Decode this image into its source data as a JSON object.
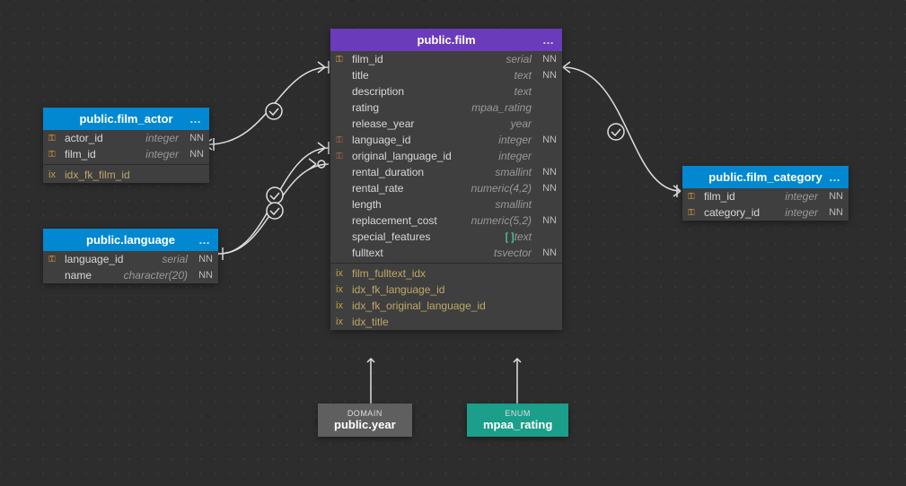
{
  "entities": {
    "film_actor": {
      "title": "public.film_actor",
      "columns": [
        {
          "icon": "pk",
          "name": "actor_id",
          "type": "integer",
          "nn": "NN"
        },
        {
          "icon": "pk",
          "name": "film_id",
          "type": "integer",
          "nn": "NN"
        }
      ],
      "indexes": [
        {
          "name": "idx_fk_film_id"
        }
      ]
    },
    "language": {
      "title": "public.language",
      "columns": [
        {
          "icon": "pk",
          "name": "language_id",
          "type": "serial",
          "nn": "NN"
        },
        {
          "icon": "",
          "name": "name",
          "type": "character(20)",
          "nn": "NN"
        }
      ],
      "indexes": []
    },
    "film": {
      "title": "public.film",
      "columns": [
        {
          "icon": "pk",
          "name": "film_id",
          "type": "serial",
          "nn": "NN"
        },
        {
          "icon": "",
          "name": "title",
          "type": "text",
          "nn": "NN"
        },
        {
          "icon": "",
          "name": "description",
          "type": "text",
          "nn": ""
        },
        {
          "icon": "",
          "name": "rating",
          "type": "mpaa_rating",
          "nn": ""
        },
        {
          "icon": "",
          "name": "release_year",
          "type": "year",
          "nn": ""
        },
        {
          "icon": "fk",
          "name": "language_id",
          "type": "integer",
          "nn": "NN"
        },
        {
          "icon": "fk",
          "name": "original_language_id",
          "type": "integer",
          "nn": ""
        },
        {
          "icon": "",
          "name": "rental_duration",
          "type": "smallint",
          "nn": "NN"
        },
        {
          "icon": "",
          "name": "rental_rate",
          "type": "numeric(4,2)",
          "nn": "NN"
        },
        {
          "icon": "",
          "name": "length",
          "type": "smallint",
          "nn": ""
        },
        {
          "icon": "",
          "name": "replacement_cost",
          "type": "numeric(5,2)",
          "nn": "NN"
        },
        {
          "icon": "",
          "name": "special_features",
          "type": "text",
          "nn": "",
          "array": true
        },
        {
          "icon": "",
          "name": "fulltext",
          "type": "tsvector",
          "nn": "NN"
        }
      ],
      "indexes": [
        {
          "name": "film_fulltext_idx"
        },
        {
          "name": "idx_fk_language_id"
        },
        {
          "name": "idx_fk_original_language_id"
        },
        {
          "name": "idx_title"
        }
      ]
    },
    "film_category": {
      "title": "public.film_category",
      "columns": [
        {
          "icon": "pk",
          "name": "film_id",
          "type": "integer",
          "nn": "NN"
        },
        {
          "icon": "pk",
          "name": "category_id",
          "type": "integer",
          "nn": "NN"
        }
      ],
      "indexes": []
    }
  },
  "types": {
    "year": {
      "label": "DOMAIN",
      "name": "public.year"
    },
    "mpaa": {
      "label": "ENUM",
      "name": "mpaa_rating"
    }
  },
  "menu_glyph": "…",
  "idx_prefix": "ix",
  "array_brackets": "[ ]"
}
